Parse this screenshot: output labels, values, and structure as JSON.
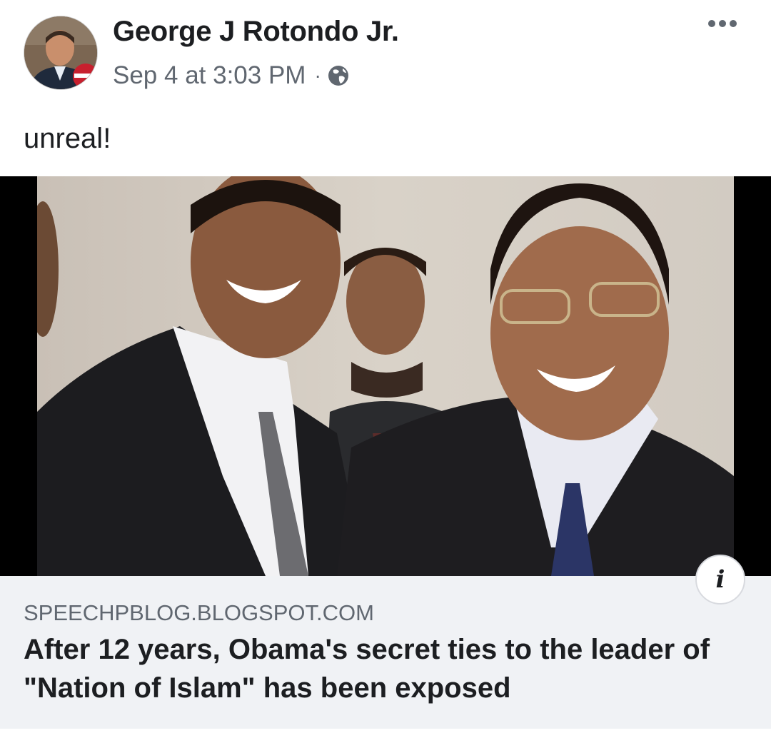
{
  "post": {
    "author_name": "George J Rotondo Jr.",
    "timestamp": "Sep 4 at 3:03 PM",
    "separator": "·",
    "privacy_icon": "globe-icon",
    "more_icon": "more-options-icon",
    "text": "unreal!"
  },
  "link_preview": {
    "domain": "SPEECHPBLOG.BLOGSPOT.COM",
    "title": "After 12 years, Obama's secret ties to the leader of \"Nation of Islam\" has been exposed",
    "info_label": "i"
  },
  "colors": {
    "name_text": "#1c1e21",
    "meta_text": "#606770",
    "card_background": "#f0f2f5"
  }
}
